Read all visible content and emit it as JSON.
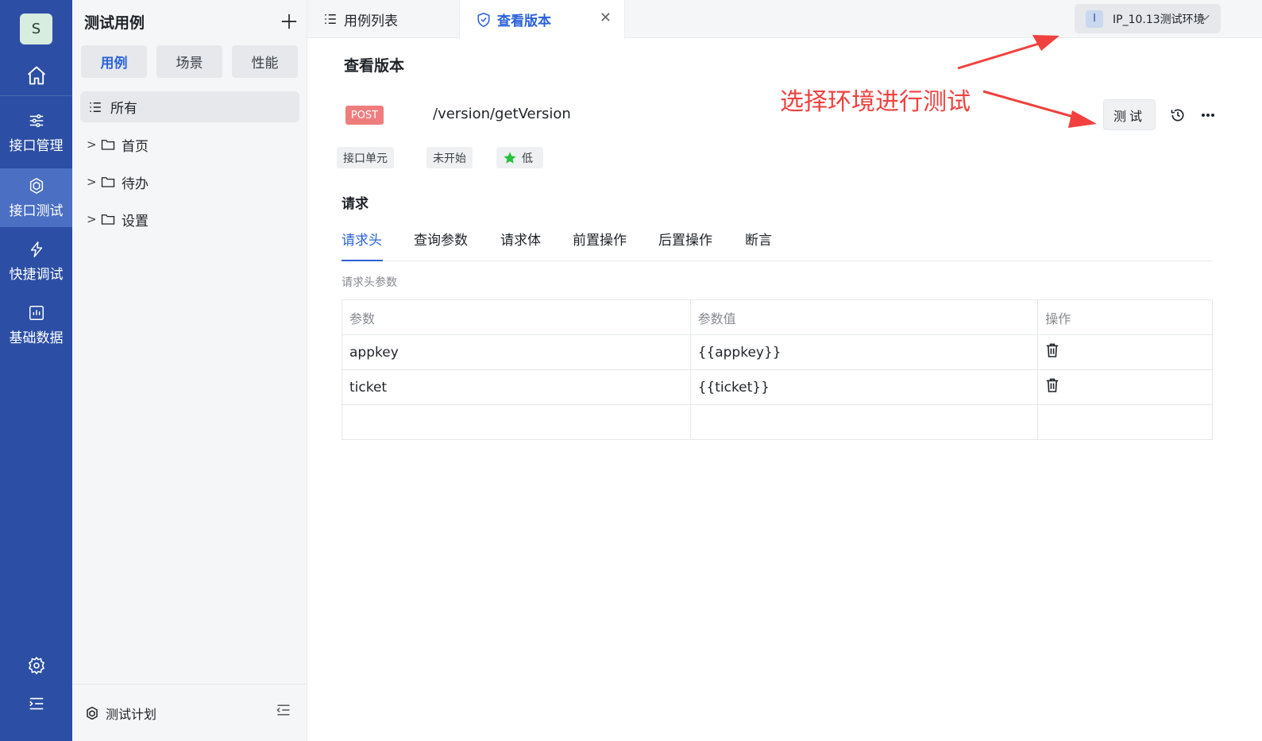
{
  "rail": {
    "avatar_letter": "S",
    "items": [
      {
        "label": "接口管理",
        "icon": "sliders-icon"
      },
      {
        "label": "接口测试",
        "icon": "cube-icon"
      },
      {
        "label": "快捷调试",
        "icon": "lightning-icon"
      },
      {
        "label": "基础数据",
        "icon": "chart-icon"
      }
    ],
    "active_index": 1
  },
  "sidebar": {
    "title": "测试用例",
    "segments": [
      "用例",
      "场景",
      "性能"
    ],
    "active_segment": "用例",
    "tree_all": "所有",
    "tree_items": [
      "首页",
      "待办",
      "设置"
    ],
    "footer_label": "测试计划"
  },
  "tabs": [
    {
      "label": "用例列表",
      "icon": "list-icon"
    },
    {
      "label": "查看版本",
      "icon": "shield-icon",
      "active": true
    }
  ],
  "env_selector": {
    "badge": "I",
    "label": "IP_10.13测试环境"
  },
  "main": {
    "title": "查看版本",
    "method": "POST",
    "path": "/version/getVersion",
    "annotation": "选择环境进行测试",
    "test_button": "测试",
    "tags": {
      "type": "接口单元",
      "status": "未开始",
      "priority": "低"
    },
    "request_title": "请求",
    "request_tabs": [
      "请求头",
      "查询参数",
      "请求体",
      "前置操作",
      "后置操作",
      "断言"
    ],
    "active_request_tab": "请求头",
    "section_label": "请求头参数",
    "table": {
      "headers": [
        "参数",
        "参数值",
        "操作"
      ],
      "rows": [
        {
          "param": "appkey",
          "value": "{{appkey}}"
        },
        {
          "param": "ticket",
          "value": "{{ticket}}"
        }
      ]
    }
  },
  "colors": {
    "rail": "#2c4fa5",
    "accent": "#2b62d9",
    "post": "#f07d7d",
    "annotation": "#f0413e"
  }
}
